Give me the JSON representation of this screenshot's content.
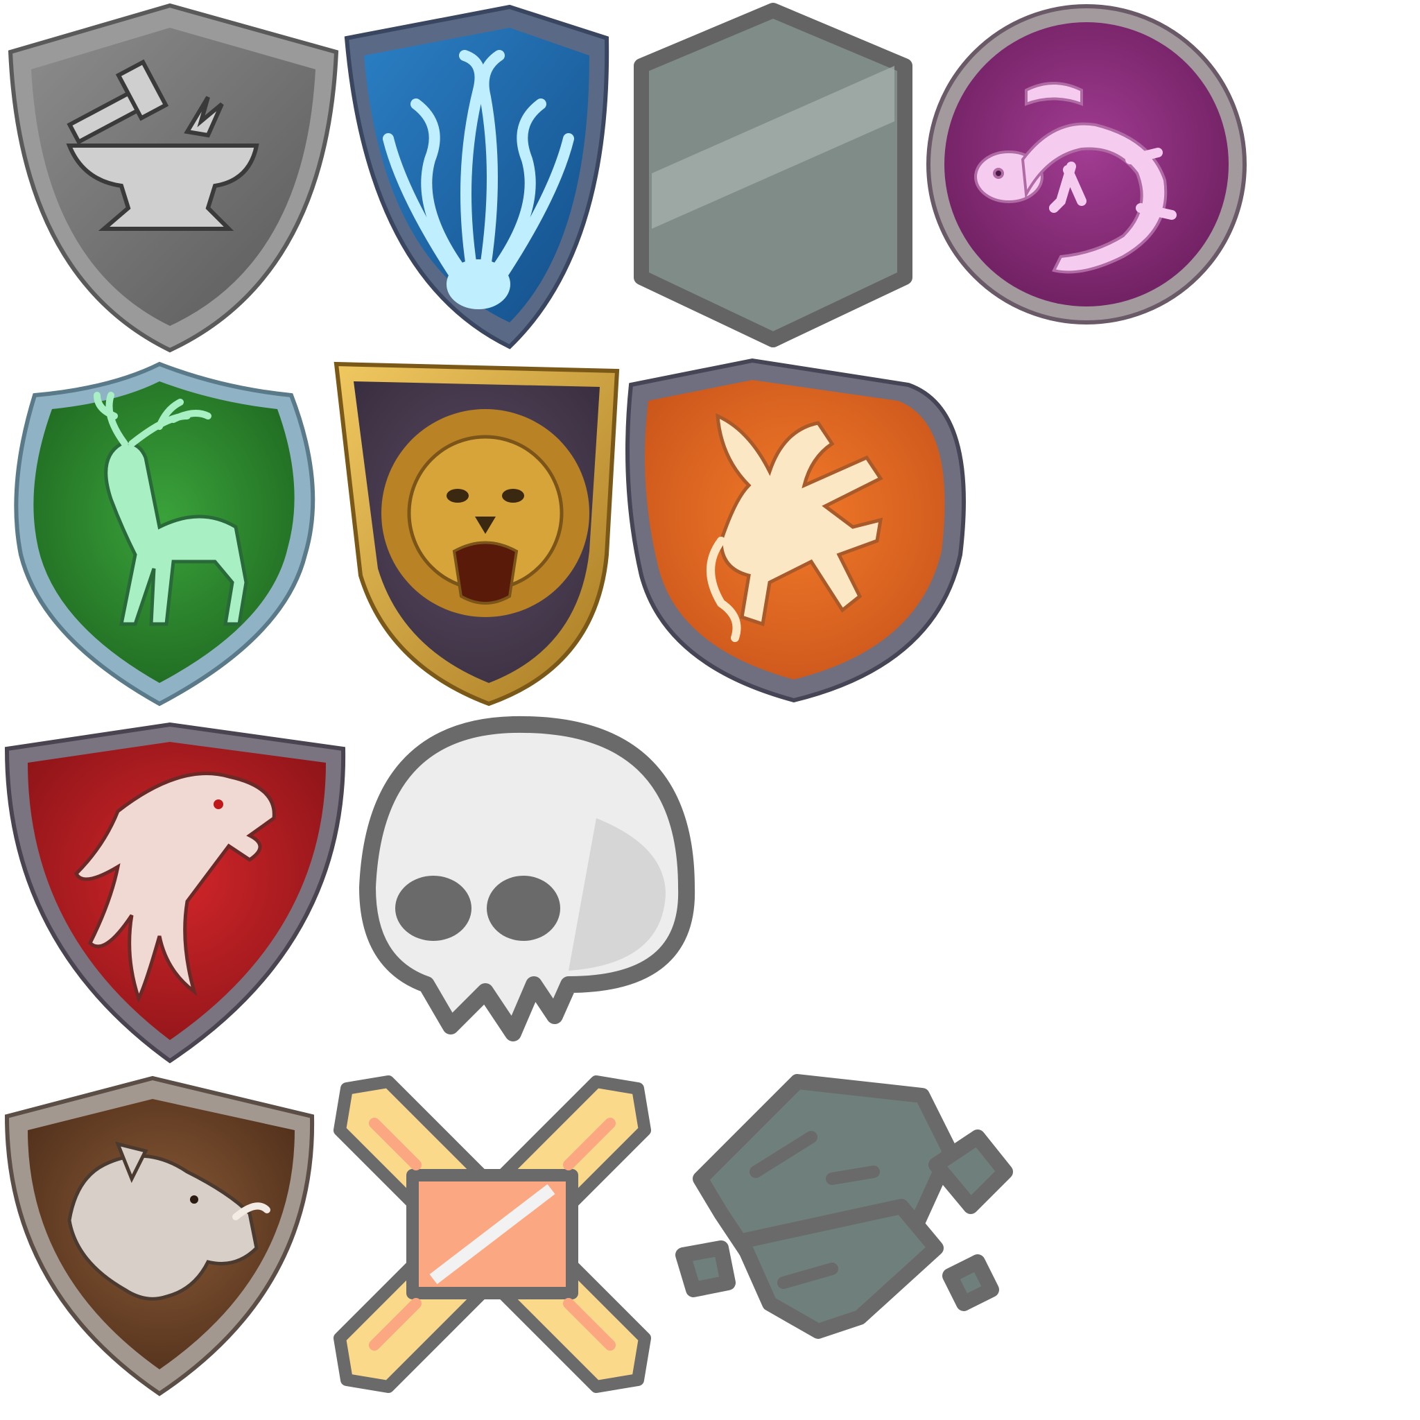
{
  "icons": [
    {
      "id": "anvil-crest",
      "icon": "anvil-hammer-icon",
      "field": "#6e6e6e",
      "rim": "#9a9a9a",
      "emblem": "#cfcfcf"
    },
    {
      "id": "kraken-crest",
      "icon": "kraken-icon",
      "field": "#1d64a6",
      "rim": "#5a6a86",
      "emblem": "#bfefff"
    },
    {
      "id": "blank-crest",
      "icon": "blank-shield-icon",
      "field": "#7f8c88",
      "rim": "#646464",
      "emblem": "#a9b3b0"
    },
    {
      "id": "salamander-crest",
      "icon": "salamander-icon",
      "field": "#8a2c7c",
      "rim": "#a39a9e",
      "emblem": "#f5ccf0"
    },
    {
      "id": "stag-crest",
      "icon": "stag-icon",
      "field": "#2f8a2e",
      "rim": "#8fb3c4",
      "emblem": "#a8f0c4"
    },
    {
      "id": "lion-crest",
      "icon": "lion-icon",
      "field": "#4a3d52",
      "rim": "#d8b650",
      "emblem": "#d7a43a"
    },
    {
      "id": "griffin-crest",
      "icon": "griffin-icon",
      "field": "#e36a1e",
      "rim": "#6f6f80",
      "emblem": "#fbe7c4"
    },
    {
      "id": "eagle-crest",
      "icon": "eagle-icon",
      "field": "#b51d22",
      "rim": "#7a7480",
      "emblem": "#efd9d2"
    },
    {
      "id": "skull-token",
      "icon": "skull-icon",
      "field": "#ededed",
      "rim": "#6a6a6a",
      "emblem": "#d6d6d6"
    },
    {
      "id": "boar-crest",
      "icon": "boar-icon",
      "field": "#6e4428",
      "rim": "#a39890",
      "emblem": "#d8cfc8"
    },
    {
      "id": "crossed-bones-token",
      "icon": "crossed-bones-icon",
      "field": "#fbd98a",
      "rim": "#6a6a6a",
      "emblem": "#fba882"
    },
    {
      "id": "broken-stone-token",
      "icon": "broken-stone-icon",
      "field": "#6f807c",
      "rim": "#6a6a6a",
      "emblem": "#8a9894"
    }
  ]
}
